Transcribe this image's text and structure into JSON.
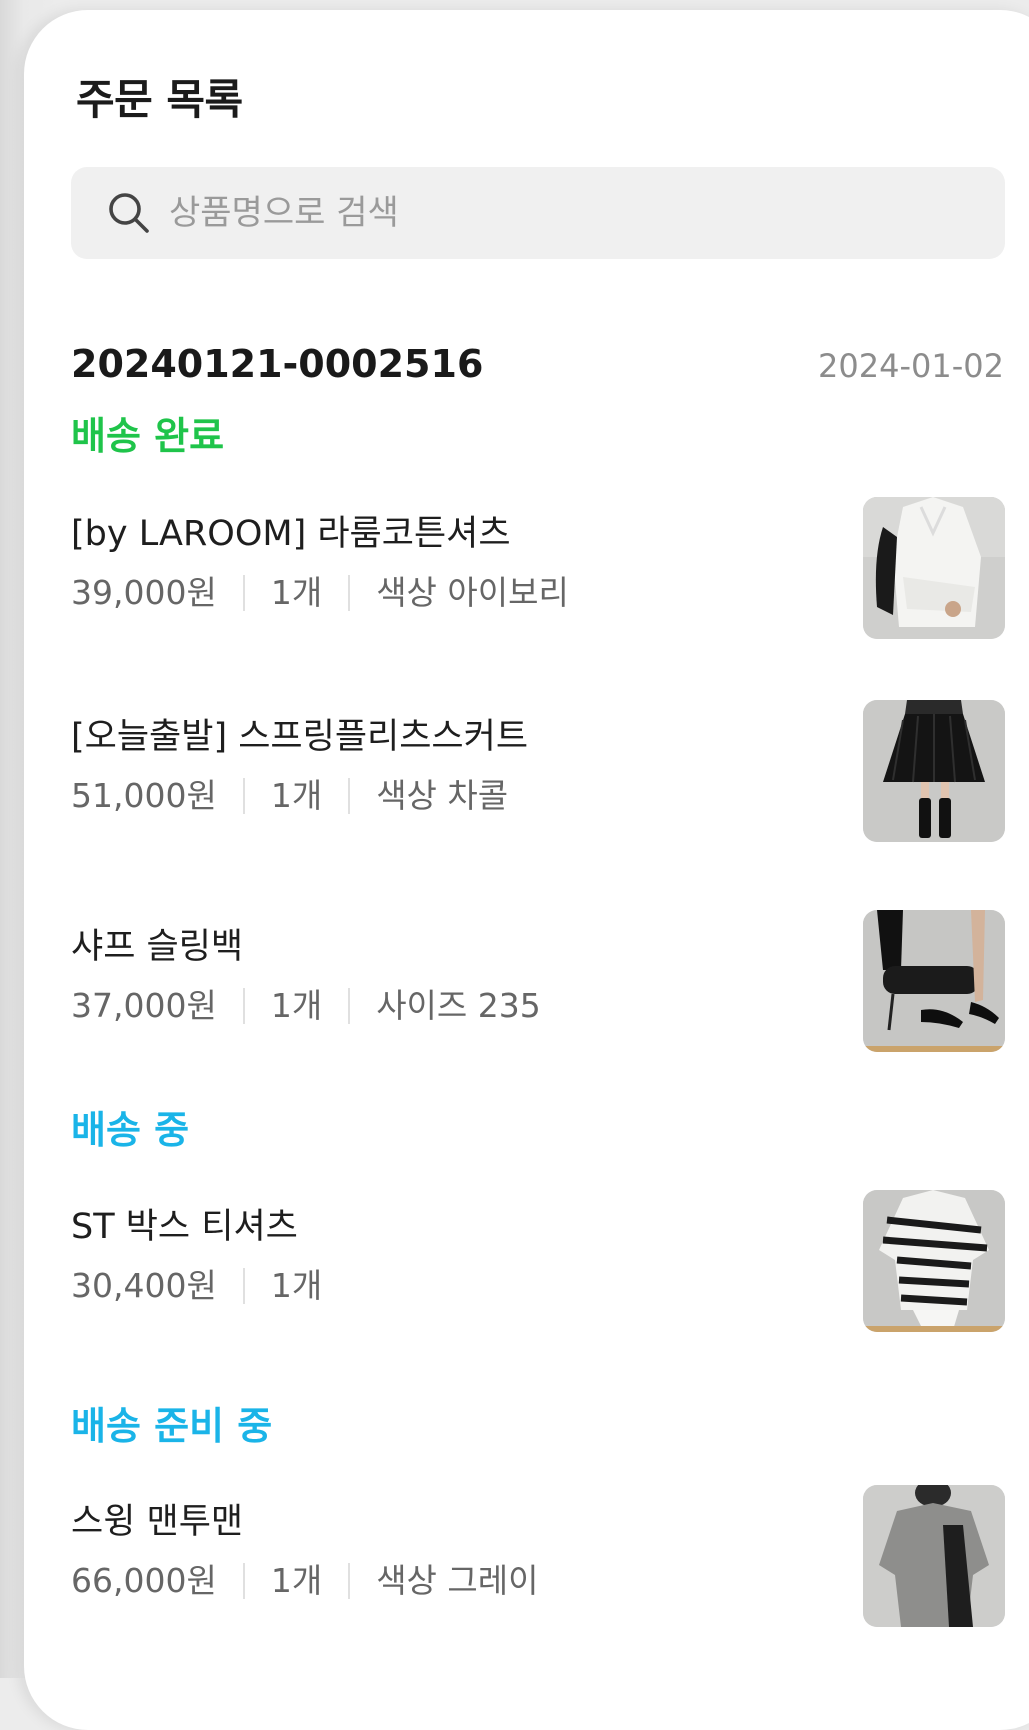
{
  "header": {
    "title": "주문 목록"
  },
  "search": {
    "placeholder": "상품명으로 검색",
    "value": ""
  },
  "order": {
    "number": "20240121-0002516",
    "date": "2024-01-02",
    "groups": [
      {
        "status": "배송 완료",
        "status_color": "#1fc44a",
        "items": [
          {
            "name": "[by LAROOM] 라룸코튼셔츠",
            "price": "39,000원",
            "qty": "1개",
            "option": "색상 아이보리",
            "image": "white-shirt"
          },
          {
            "name": "[오늘출발] 스프링플리츠스커트",
            "price": "51,000원",
            "qty": "1개",
            "option": "색상 차콜",
            "image": "pleated-skirt"
          },
          {
            "name": "샤프 슬링백",
            "price": "37,000원",
            "qty": "1개",
            "option": "사이즈 235",
            "image": "slingback-shoes"
          }
        ]
      },
      {
        "status": "배송 중",
        "status_color": "#1ab4e8",
        "items": [
          {
            "name": "ST 박스 티셔츠",
            "price": "30,400원",
            "qty": "1개",
            "option": "",
            "image": "striped-tshirt"
          }
        ]
      },
      {
        "status": "배송 준비 중",
        "status_color": "#1ab4e8",
        "items": [
          {
            "name": "스윙 맨투맨",
            "price": "66,000원",
            "qty": "1개",
            "option": "색상 그레이",
            "image": "grey-sweatshirt"
          }
        ]
      }
    ]
  }
}
